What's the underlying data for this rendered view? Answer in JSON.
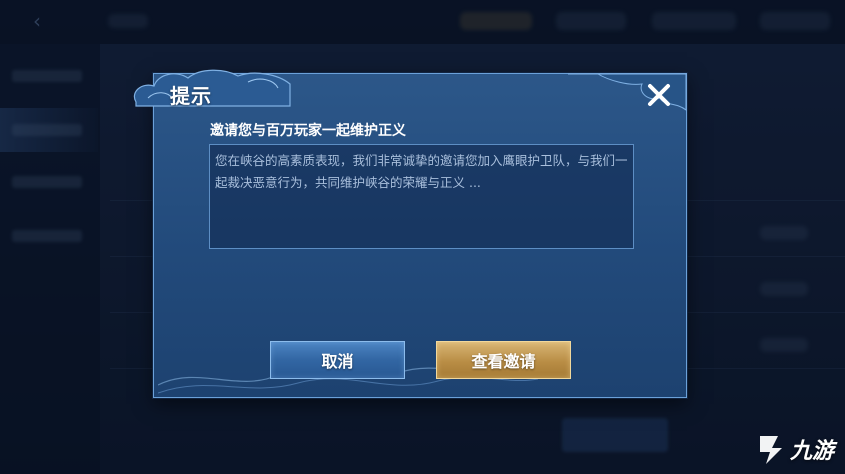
{
  "dialog": {
    "title": "提示",
    "heading": "邀请您与百万玩家一起维护正义",
    "message": "您在峡谷的高素质表现，我们非常诚挚的邀请您加入鹰眼护卫队，与我们一起裁决恶意行为，共同维护峡谷的荣耀与正义 ...",
    "cancel_label": "取消",
    "view_label": "查看邀请",
    "close_icon": "close-icon"
  },
  "watermark": {
    "text": "九游"
  },
  "colors": {
    "dialog_bg": "#2c5789",
    "dialog_border": "#6ba1d9",
    "cancel_button": "#3266a3",
    "view_button": "#b98d45",
    "message_text": "#a9bfdc"
  }
}
